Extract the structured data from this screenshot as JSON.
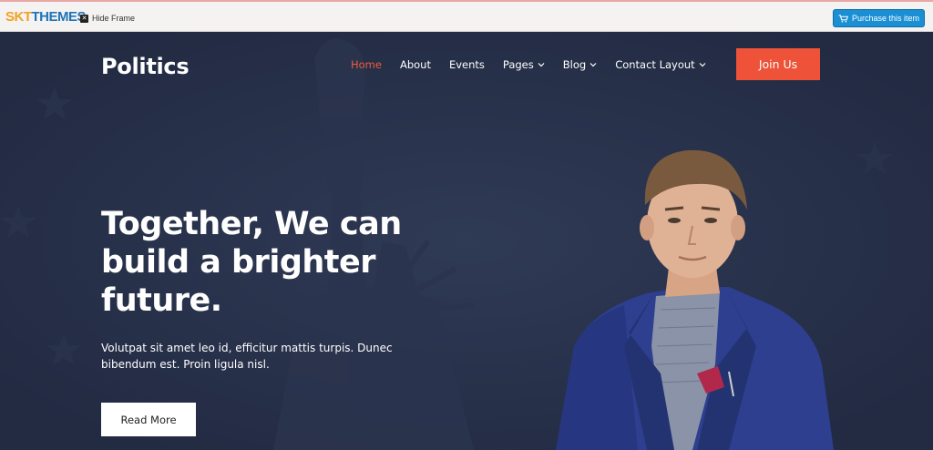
{
  "frame": {
    "logo_part1": "SKT",
    "logo_part2": "THEMES",
    "hide_frame_label": "Hide Frame",
    "purchase_label": "Purchase this item",
    "colors": {
      "accent": "#1a8fd3",
      "logo_orange": "#f0a224",
      "logo_blue": "#1f74b8"
    }
  },
  "header": {
    "site_title": "Politics",
    "nav": [
      {
        "label": "Home",
        "active": true,
        "dropdown": false
      },
      {
        "label": "About",
        "active": false,
        "dropdown": false
      },
      {
        "label": "Events",
        "active": false,
        "dropdown": false
      },
      {
        "label": "Pages",
        "active": false,
        "dropdown": true
      },
      {
        "label": "Blog",
        "active": false,
        "dropdown": true
      },
      {
        "label": "Contact Layout",
        "active": false,
        "dropdown": true
      }
    ],
    "cta_label": "Join Us"
  },
  "hero": {
    "headline": "Together, We can build a brighter future.",
    "lead": "Volutpat sit amet leo id, efficitur mattis turpis. Dunec bibendum est. Proin ligula nisl.",
    "button_label": "Read More"
  },
  "icons": {
    "hide_frame": "close-box-icon",
    "purchase": "cart-icon",
    "dropdown": "chevron-down-icon"
  },
  "colors": {
    "hero_bg": "#232b43",
    "accent": "#ee5238",
    "text": "#ffffff"
  }
}
